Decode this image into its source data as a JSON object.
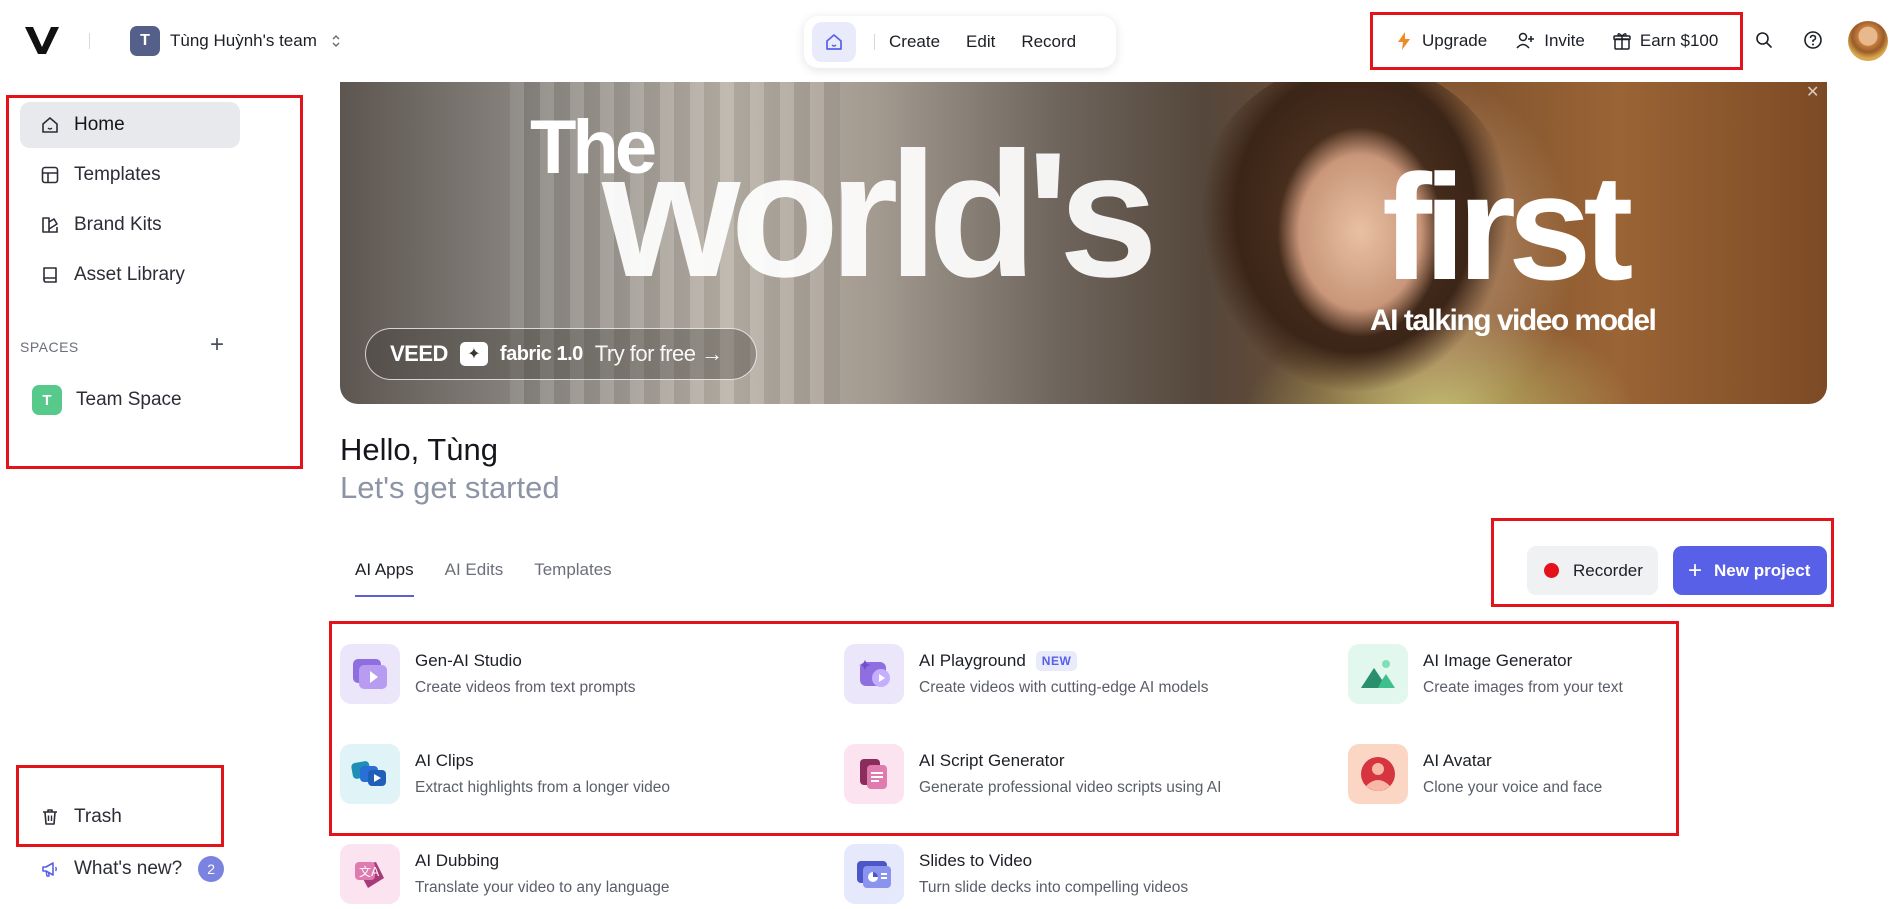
{
  "header": {
    "team_initial": "T",
    "team_name": "Tùng Huỳnh's team",
    "nav": {
      "create": "Create",
      "edit": "Edit",
      "record": "Record"
    },
    "actions": {
      "upgrade": "Upgrade",
      "invite": "Invite",
      "earn": "Earn $100"
    },
    "icons": [
      "veed-logo-icon",
      "chevron-up-down-icon",
      "home-icon",
      "bolt-icon",
      "user-plus-icon",
      "gift-icon",
      "search-icon",
      "help-icon"
    ]
  },
  "sidebar": {
    "items": [
      {
        "label": "Home",
        "icon": "home-icon"
      },
      {
        "label": "Templates",
        "icon": "templates-icon"
      },
      {
        "label": "Brand Kits",
        "icon": "brand-kit-icon"
      },
      {
        "label": "Asset Library",
        "icon": "book-icon"
      }
    ],
    "spaces_label": "SPACES",
    "space": {
      "initial": "T",
      "name": "Team Space"
    },
    "trash": "Trash",
    "whats_new": "What's new?",
    "whats_new_count": "2"
  },
  "hero": {
    "line1": "The",
    "line2": "world's",
    "line3": "first",
    "tagline": "AI talking video model",
    "cta_brand": "VEED",
    "cta_product": "fabric 1.0",
    "cta_text": "Try for free →"
  },
  "greeting": {
    "hello": "Hello, Tùng",
    "sub": "Let's get started"
  },
  "tabs": [
    "AI Apps",
    "AI Edits",
    "Templates"
  ],
  "buttons": {
    "recorder": "Recorder",
    "new_project": "New project"
  },
  "apps": [
    {
      "title": "Gen-AI Studio",
      "desc": "Create videos from text prompts"
    },
    {
      "title": "AI Playground",
      "badge": "NEW",
      "desc": "Create videos with cutting-edge AI models"
    },
    {
      "title": "AI Image Generator",
      "desc": "Create images from your text"
    },
    {
      "title": "AI Clips",
      "desc": "Extract highlights from a longer video"
    },
    {
      "title": "AI Script Generator",
      "desc": "Generate professional video scripts using AI"
    },
    {
      "title": "AI Avatar",
      "desc": "Clone your voice and face"
    },
    {
      "title": "AI Dubbing",
      "desc": "Translate your video to any language"
    },
    {
      "title": "Slides to Video",
      "desc": "Turn slide decks into compelling videos"
    }
  ],
  "colors": {
    "accent": "#5960e8",
    "highlight_box": "#e3121b",
    "record_dot": "#e3121b"
  }
}
